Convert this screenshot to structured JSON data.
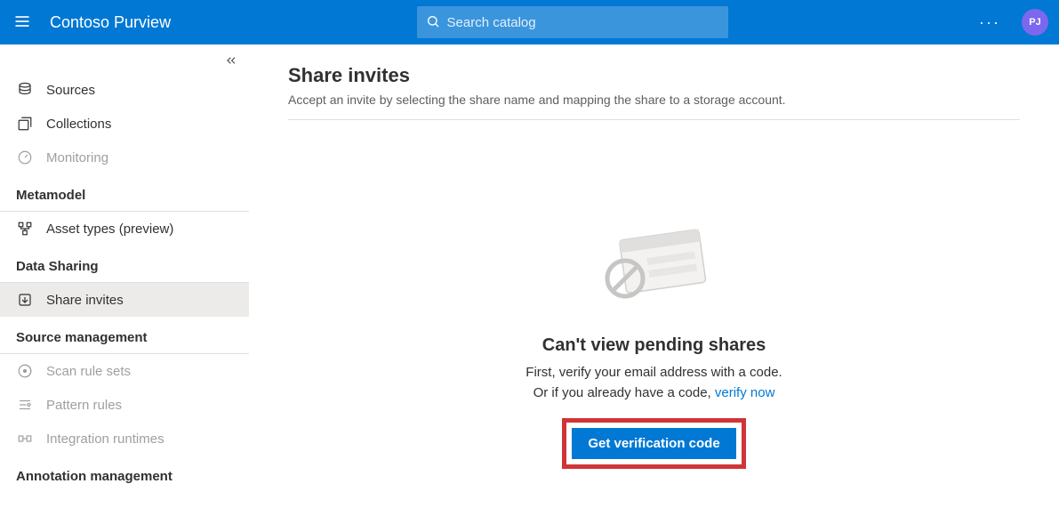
{
  "header": {
    "brand": "Contoso Purview",
    "search_placeholder": "Search catalog",
    "avatar_initials": "PJ"
  },
  "sidebar": {
    "items": [
      {
        "label": "Sources"
      },
      {
        "label": "Collections"
      },
      {
        "label": "Monitoring"
      }
    ],
    "headings": {
      "metamodel": "Metamodel",
      "data_sharing": "Data Sharing",
      "source_management": "Source management",
      "annotation_management": "Annotation management"
    },
    "metamodel_items": [
      {
        "label": "Asset types (preview)"
      }
    ],
    "data_sharing_items": [
      {
        "label": "Share invites"
      }
    ],
    "source_mgmt_items": [
      {
        "label": "Scan rule sets"
      },
      {
        "label": "Pattern rules"
      },
      {
        "label": "Integration runtimes"
      }
    ]
  },
  "main": {
    "title": "Share invites",
    "subtitle": "Accept an invite by selecting the share name and mapping the share to a storage account.",
    "empty": {
      "title": "Can't view pending shares",
      "line1": "First, verify your email address with a code.",
      "line2_prefix": "Or if you already have a code, ",
      "line2_link": "verify now",
      "button": "Get verification code"
    }
  }
}
